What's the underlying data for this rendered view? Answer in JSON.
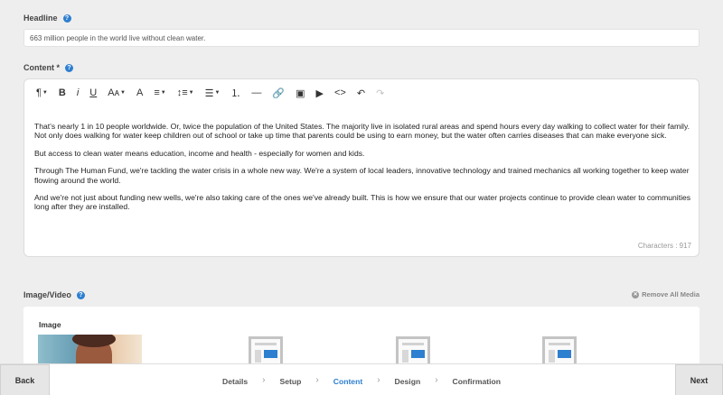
{
  "headline": {
    "label": "Headline",
    "value": "663 million people in the world live without clean water."
  },
  "content": {
    "label": "Content *",
    "toolbar": [
      {
        "name": "paragraph-format-icon",
        "glyph": "¶",
        "caret": true
      },
      {
        "name": "bold-icon",
        "glyph": "B",
        "caret": false
      },
      {
        "name": "italic-icon",
        "glyph": "i",
        "caret": false
      },
      {
        "name": "underline-icon",
        "glyph": "U",
        "caret": false
      },
      {
        "name": "font-size-icon",
        "glyph": "Aᴀ",
        "caret": true
      },
      {
        "name": "text-color-icon",
        "glyph": "A",
        "caret": false
      },
      {
        "name": "align-icon",
        "glyph": "≡",
        "caret": true
      },
      {
        "name": "line-height-icon",
        "glyph": "↕≡",
        "caret": true
      },
      {
        "name": "bullet-list-icon",
        "glyph": "☰",
        "caret": true
      },
      {
        "name": "numbered-list-icon",
        "glyph": "⒈",
        "caret": false
      },
      {
        "name": "horizontal-rule-icon",
        "glyph": "—",
        "caret": false
      },
      {
        "name": "link-icon",
        "glyph": "🔗",
        "caret": false
      },
      {
        "name": "image-icon",
        "glyph": "▣",
        "caret": false
      },
      {
        "name": "video-icon",
        "glyph": "▶",
        "caret": false
      },
      {
        "name": "code-icon",
        "glyph": "<>",
        "caret": false
      },
      {
        "name": "undo-icon",
        "glyph": "↶",
        "caret": false
      },
      {
        "name": "redo-icon",
        "glyph": "↷",
        "caret": false,
        "disabled": true
      }
    ],
    "paragraphs": [
      "That's nearly 1 in 10 people worldwide. Or, twice the population of the United States. The majority live in isolated rural areas and spend hours every day walking to collect water for their family. Not only does walking for water keep children out of school or take up time that parents could be using to earn money, but the water often carries diseases that can make everyone sick.",
      "But access to clean water means education, income and health - especially for women and kids.",
      "Through The Human Fund, we're tackling the water crisis in a whole new way. We're a system of local leaders, innovative technology and trained mechanics all working together to keep water flowing around the world.",
      "And we're not just about funding new wells, we're also taking care of the ones we've already built. This is how we ensure that our water projects continue to provide clean water to communities long after they are installed."
    ],
    "char_count": "Characters : 917"
  },
  "media": {
    "label": "Image/Video",
    "remove_all": "Remove All Media",
    "image_label": "Image",
    "accent": "#2d7fd0"
  },
  "footer": {
    "back": "Back",
    "next": "Next",
    "steps": [
      "Details",
      "Setup",
      "Content",
      "Design",
      "Confirmation"
    ],
    "active_step": "Content",
    "separator": "›"
  }
}
